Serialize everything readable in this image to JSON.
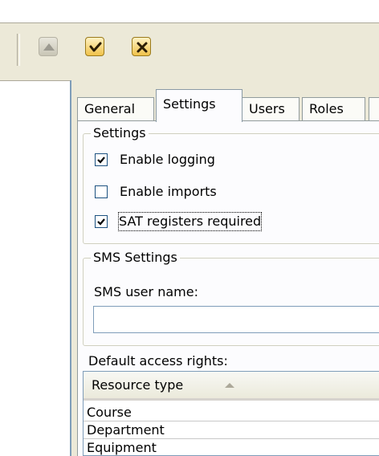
{
  "toolbar": {
    "buttons": [
      {
        "icon": "up-arrow-icon"
      },
      {
        "icon": "checkmark-icon"
      },
      {
        "icon": "close-x-icon"
      }
    ]
  },
  "tabs": [
    {
      "label": "General"
    },
    {
      "label": "Settings",
      "active": true
    },
    {
      "label": "Users"
    },
    {
      "label": "Roles"
    }
  ],
  "settings_group": {
    "legend": "Settings",
    "options": [
      {
        "label": "Enable logging",
        "checked": true
      },
      {
        "label": "Enable imports",
        "checked": false
      },
      {
        "label": "SAT registers required",
        "checked": true
      }
    ]
  },
  "sms_group": {
    "legend": "SMS Settings",
    "user_name_label": "SMS user name:",
    "user_name_value": ""
  },
  "access_rights": {
    "label": "Default access rights:",
    "column_header": "Resource type",
    "rows": [
      "Course",
      "Department",
      "Equipment"
    ]
  }
}
